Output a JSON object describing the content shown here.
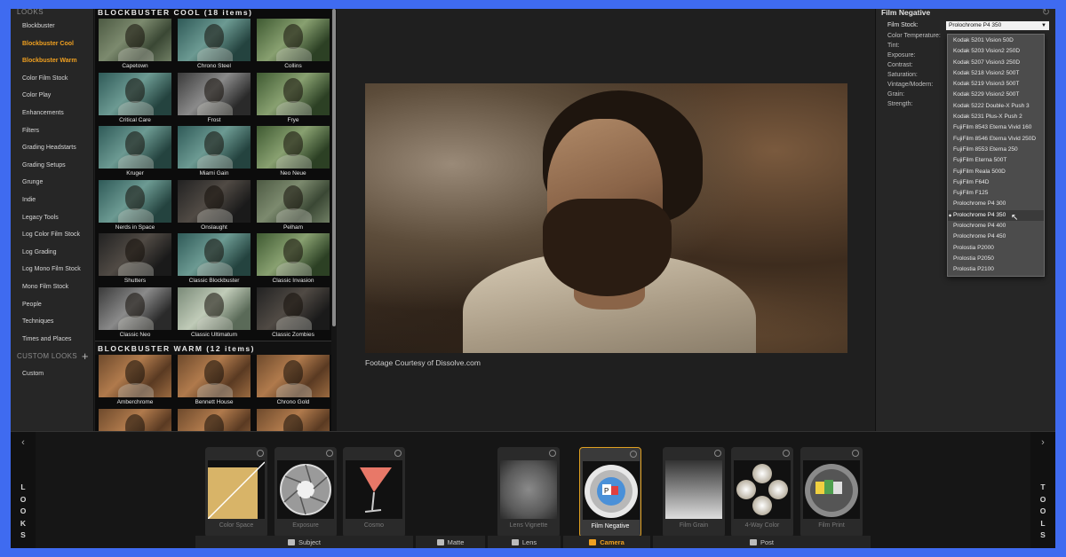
{
  "sidebar": {
    "header": "LOOKS",
    "items": [
      {
        "label": "Blockbuster",
        "active": false
      },
      {
        "label": "Blockbuster Cool",
        "active": true
      },
      {
        "label": "Blockbuster Warm",
        "active": true
      },
      {
        "label": "Color Film Stock",
        "active": false
      },
      {
        "label": "Color Play",
        "active": false
      },
      {
        "label": "Enhancements",
        "active": false
      },
      {
        "label": "Filters",
        "active": false
      },
      {
        "label": "Grading Headstarts",
        "active": false
      },
      {
        "label": "Grading Setups",
        "active": false
      },
      {
        "label": "Grunge",
        "active": false
      },
      {
        "label": "Indie",
        "active": false
      },
      {
        "label": "Legacy Tools",
        "active": false
      },
      {
        "label": "Log Color Film Stock",
        "active": false
      },
      {
        "label": "Log Grading",
        "active": false
      },
      {
        "label": "Log Mono Film Stock",
        "active": false
      },
      {
        "label": "Mono Film Stock",
        "active": false
      },
      {
        "label": "People",
        "active": false
      },
      {
        "label": "Techniques",
        "active": false
      },
      {
        "label": "Times and Places",
        "active": false
      }
    ],
    "custom_header": "CUSTOM LOOKS",
    "custom_items": [
      "Custom"
    ]
  },
  "looks": {
    "cool_title": "BLOCKBUSTER COOL (18 items)",
    "cool": [
      {
        "label": "Capetown",
        "tone": ""
      },
      {
        "label": "Chrono Steel",
        "tone": "t-teal"
      },
      {
        "label": "Collins",
        "tone": "t-green"
      },
      {
        "label": "Critical Care",
        "tone": "t-teal"
      },
      {
        "label": "Frost",
        "tone": "t-mono"
      },
      {
        "label": "Frye",
        "tone": "t-green"
      },
      {
        "label": "Kruger",
        "tone": "t-teal"
      },
      {
        "label": "Miami Gain",
        "tone": "t-teal"
      },
      {
        "label": "Neo Neue",
        "tone": "t-green"
      },
      {
        "label": "Nerds in Space",
        "tone": "t-teal"
      },
      {
        "label": "Onslaught",
        "tone": "t-dark"
      },
      {
        "label": "Pelham",
        "tone": ""
      },
      {
        "label": "Shutters",
        "tone": "t-dark"
      },
      {
        "label": "Classic Blockbuster",
        "tone": "t-teal"
      },
      {
        "label": "Classic Invasion",
        "tone": "t-green"
      },
      {
        "label": "Classic Neo",
        "tone": "t-mono"
      },
      {
        "label": "Classic Ultimatum",
        "tone": "t-bright"
      },
      {
        "label": "Classic Zombies",
        "tone": "t-dark"
      }
    ],
    "warm_title": "BLOCKBUSTER WARM (12 items)",
    "warm": [
      {
        "label": "Amberchrome"
      },
      {
        "label": "Bennett House"
      },
      {
        "label": "Chrono Gold"
      },
      {
        "label": ""
      },
      {
        "label": ""
      },
      {
        "label": ""
      }
    ]
  },
  "viewer": {
    "caption": "Footage Courtesy of Dissolve.com"
  },
  "panel": {
    "title": "Film Negative",
    "film_stock_label": "Film Stock:",
    "film_stock_value": "Prolochrome P4 350",
    "params": [
      "Color Temperature:",
      "Tint:",
      "Exposure:",
      "Contrast:",
      "Saturation:",
      "Vintage/Modern:",
      "Grain:",
      "Strength:"
    ],
    "options": [
      "Kodak 5201 Vision 50D",
      "Kodak 5203 Vision2 250D",
      "Kodak 5207 Vision3 250D",
      "Kodak 5218 Vision2 500T",
      "Kodak 5219 Vision3 500T",
      "Kodak 5229 Vision2 500T",
      "Kodak 5222 Double-X Push 3",
      "Kodak 5231 Plus-X Push 2",
      "FujiFilm 8543 Eterna Vivid 160",
      "FujiFilm 8546 Eterna Vivid 250D",
      "FujiFilm 8553 Eterna 250",
      "FujiFilm Eterna 500T",
      "FujiFilm Reala 500D",
      "FujiFilm F64D",
      "FujiFilm F125",
      "Prolochrome P4 300",
      "Prolochrome P4 350",
      "Prolochrome P4 400",
      "Prolochrome P4 450",
      "Prolostia P2000",
      "Prolostia P2050",
      "Prolostia P2100"
    ],
    "selected_index": 16
  },
  "bottom": {
    "left_tab": "LOOKS",
    "right_tab": "TOOLS",
    "tools": [
      {
        "label": "Color Space",
        "icon": "color-space-icon"
      },
      {
        "label": "Exposure",
        "icon": "aperture-icon"
      },
      {
        "label": "Cosmo",
        "icon": "cocktail-glass-icon"
      },
      {
        "label": "Lens Vignette",
        "icon": "vignette-icon"
      },
      {
        "label": "Film Negative",
        "icon": "film-reel-icon"
      },
      {
        "label": "Film Grain",
        "icon": "gradient-icon"
      },
      {
        "label": "4-Way Color",
        "icon": "four-way-color-icon"
      },
      {
        "label": "Film Print",
        "icon": "film-print-icon"
      }
    ],
    "tabs": [
      {
        "label": "Subject",
        "active": false
      },
      {
        "label": "Matte",
        "active": false
      },
      {
        "label": "Lens",
        "active": false
      },
      {
        "label": "Camera",
        "active": true
      },
      {
        "label": "Post",
        "active": false
      }
    ]
  }
}
